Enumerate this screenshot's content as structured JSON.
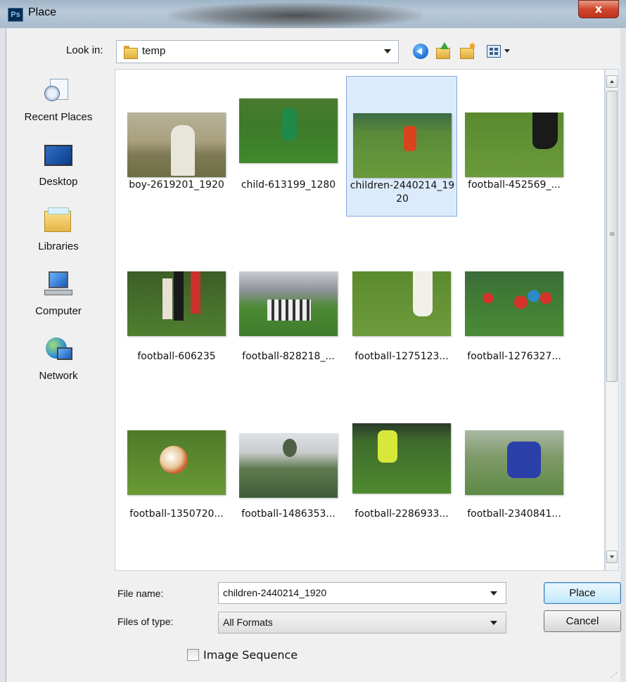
{
  "window": {
    "app_icon_text": "Ps",
    "title": "Place",
    "close_glyph": "x"
  },
  "toolbar": {
    "look_in_label": "Look in:",
    "look_in_value": "temp",
    "icons": [
      "back-icon",
      "up-folder-icon",
      "new-folder-icon",
      "views-menu-icon"
    ]
  },
  "places": [
    {
      "label": "Recent Places",
      "icon": "recent-places-icon"
    },
    {
      "label": "Desktop",
      "icon": "desktop-icon"
    },
    {
      "label": "Libraries",
      "icon": "libraries-icon"
    },
    {
      "label": "Computer",
      "icon": "computer-icon"
    },
    {
      "label": "Network",
      "icon": "network-icon"
    }
  ],
  "files": [
    {
      "name": "boy-2619201_1920",
      "selected": false
    },
    {
      "name": "child-613199_1280",
      "selected": false
    },
    {
      "name": "children-2440214_1920",
      "selected": true
    },
    {
      "name": "football-452569_...",
      "selected": false
    },
    {
      "name": "football-606235",
      "selected": false
    },
    {
      "name": "football-828218_...",
      "selected": false
    },
    {
      "name": "football-1275123...",
      "selected": false
    },
    {
      "name": "football-1276327...",
      "selected": false
    },
    {
      "name": "football-1350720...",
      "selected": false
    },
    {
      "name": "football-1486353...",
      "selected": false
    },
    {
      "name": "football-2286933...",
      "selected": false
    },
    {
      "name": "football-2340841...",
      "selected": false
    }
  ],
  "bottom": {
    "file_name_label": "File name:",
    "file_name_value": "children-2440214_1920",
    "files_of_type_label": "Files of type:",
    "files_of_type_value": "All Formats",
    "place_button": "Place",
    "cancel_button": "Cancel",
    "image_sequence_label": "Image Sequence",
    "image_sequence_checked": false
  },
  "colors": {
    "selection_bg": "#dcebfb",
    "selection_border": "#84acdd",
    "close_button": "#c0341e",
    "default_button_border": "#3c7fb1"
  }
}
